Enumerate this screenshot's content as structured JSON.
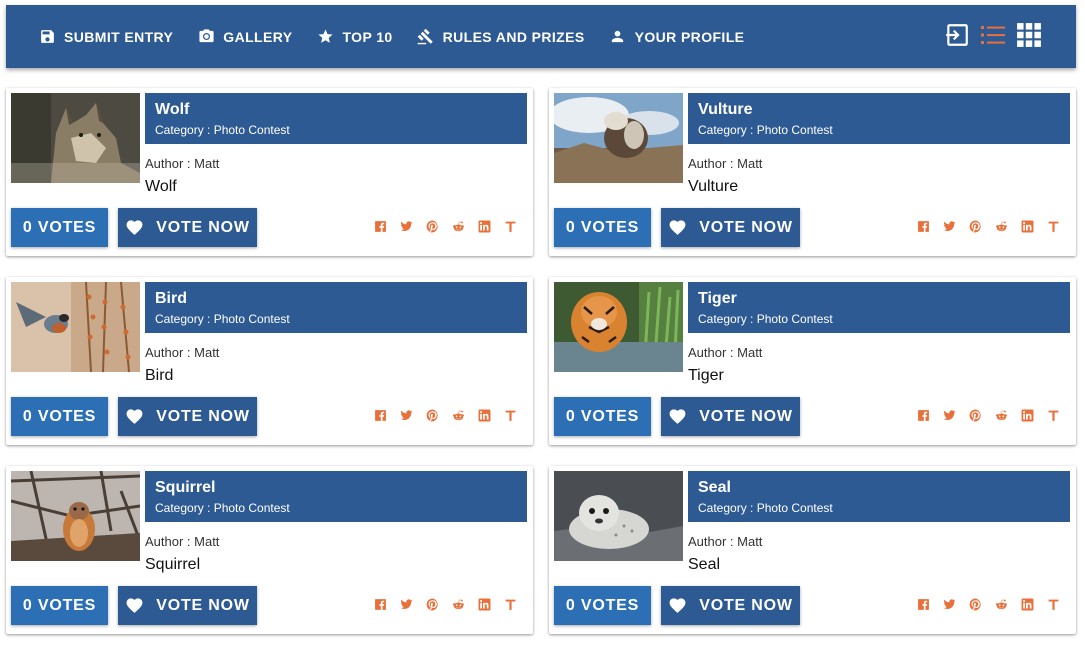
{
  "nav": {
    "items": [
      {
        "label": "SUBMIT ENTRY",
        "icon": "save-icon"
      },
      {
        "label": "GALLERY",
        "icon": "camera-icon"
      },
      {
        "label": "TOP 10",
        "icon": "star-icon"
      },
      {
        "label": "RULES AND PRIZES",
        "icon": "gavel-icon"
      },
      {
        "label": "YOUR PROFILE",
        "icon": "person-icon"
      }
    ],
    "view_controls": [
      "exit-to-app-icon",
      "list-view-icon",
      "grid-view-icon"
    ]
  },
  "colors": {
    "primary": "#2e5a94",
    "votes_button": "#2c6fb4",
    "share_icon": "#e8703a"
  },
  "entries": [
    {
      "title": "Wolf",
      "category": "Category : Photo Contest",
      "author": "Author : Matt",
      "caption": "Wolf",
      "votes": "0 VOTES",
      "vote_label": "VOTE NOW"
    },
    {
      "title": "Vulture",
      "category": "Category : Photo Contest",
      "author": "Author : Matt",
      "caption": "Vulture",
      "votes": "0 VOTES",
      "vote_label": "VOTE NOW"
    },
    {
      "title": "Bird",
      "category": "Category : Photo Contest",
      "author": "Author : Matt",
      "caption": "Bird",
      "votes": "0 VOTES",
      "vote_label": "VOTE NOW"
    },
    {
      "title": "Tiger",
      "category": "Category : Photo Contest",
      "author": "Author : Matt",
      "caption": "Tiger",
      "votes": "0 VOTES",
      "vote_label": "VOTE NOW"
    },
    {
      "title": "Squirrel",
      "category": "Category : Photo Contest",
      "author": "Author : Matt",
      "caption": "Squirrel",
      "votes": "0 VOTES",
      "vote_label": "VOTE NOW"
    },
    {
      "title": "Seal",
      "category": "Category : Photo Contest",
      "author": "Author : Matt",
      "caption": "Seal",
      "votes": "0 VOTES",
      "vote_label": "VOTE NOW"
    }
  ],
  "share_icons": [
    "facebook-icon",
    "twitter-icon",
    "pinterest-icon",
    "reddit-icon",
    "linkedin-icon",
    "tumblr-icon"
  ]
}
